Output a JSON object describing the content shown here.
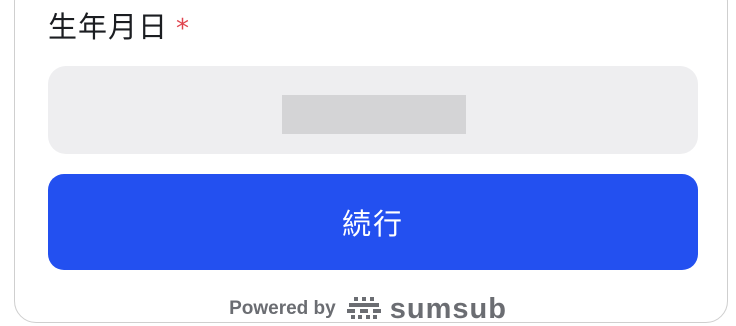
{
  "form": {
    "birthdate_label": "生年月日",
    "required_mark": "*",
    "birthdate_value": ""
  },
  "actions": {
    "continue_label": "続行",
    "continue_color": "#2350f0"
  },
  "footer": {
    "powered_by": "Powered by",
    "brand_icon": "sumsub-logo-icon",
    "brand_name": "sumsub"
  }
}
